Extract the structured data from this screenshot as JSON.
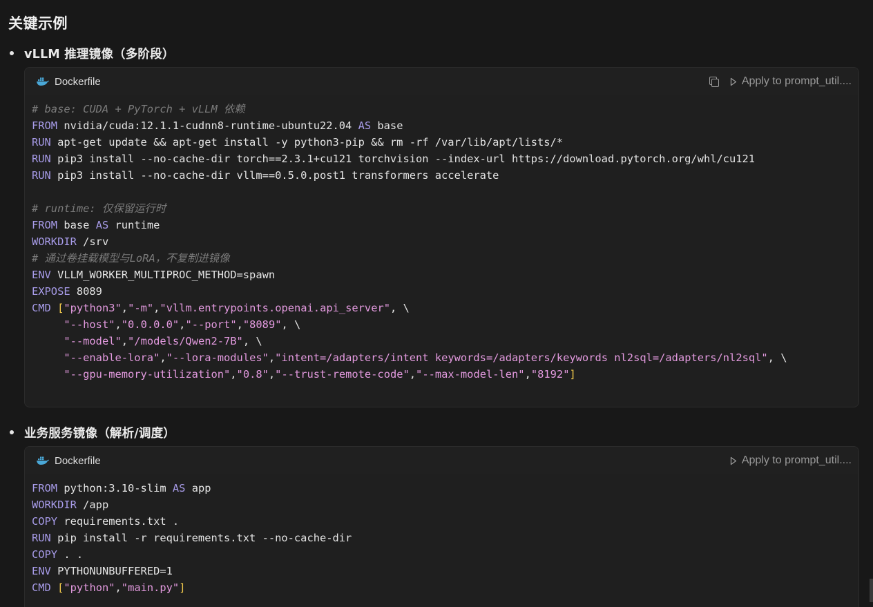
{
  "heading": "关键示例",
  "sections": [
    {
      "bullet": "vLLM 推理镜像（多阶段）",
      "filename": "Dockerfile",
      "apply_label": "Apply to prompt_util....",
      "code_lines": [
        [
          {
            "t": "# base: CUDA + PyTorch + vLLM 依赖",
            "c": "cm"
          }
        ],
        [
          {
            "t": "FROM",
            "c": "kw"
          },
          {
            "t": " nvidia/cuda:12.1.1-cudnn8-runtime-ubuntu22.04 "
          },
          {
            "t": "AS",
            "c": "kw"
          },
          {
            "t": " base"
          }
        ],
        [
          {
            "t": "RUN",
            "c": "kw"
          },
          {
            "t": " apt-get update && apt-get install -y python3-pip && rm -rf /var/lib/apt/lists/*"
          }
        ],
        [
          {
            "t": "RUN",
            "c": "kw"
          },
          {
            "t": " pip3 install --no-cache-dir torch==2.3.1+cu121 torchvision --index-url https://download.pytorch.org/whl/cu121"
          }
        ],
        [
          {
            "t": "RUN",
            "c": "kw"
          },
          {
            "t": " pip3 install --no-cache-dir vllm==0.5.0.post1 transformers accelerate"
          }
        ],
        [
          {
            "t": ""
          }
        ],
        [
          {
            "t": "# runtime: 仅保留运行时",
            "c": "cm"
          }
        ],
        [
          {
            "t": "FROM",
            "c": "kw"
          },
          {
            "t": " base "
          },
          {
            "t": "AS",
            "c": "kw"
          },
          {
            "t": " runtime"
          }
        ],
        [
          {
            "t": "WORKDIR",
            "c": "kw"
          },
          {
            "t": " /srv"
          }
        ],
        [
          {
            "t": "# 通过卷挂载模型与LoRA，不复制进镜像",
            "c": "cm"
          }
        ],
        [
          {
            "t": "ENV",
            "c": "kw"
          },
          {
            "t": " VLLM_WORKER_MULTIPROC_METHOD=spawn"
          }
        ],
        [
          {
            "t": "EXPOSE",
            "c": "kw"
          },
          {
            "t": " 8089"
          }
        ],
        [
          {
            "t": "CMD",
            "c": "kw"
          },
          {
            "t": " "
          },
          {
            "t": "[",
            "c": "br"
          },
          {
            "t": "\"python3\"",
            "c": "str"
          },
          {
            "t": ","
          },
          {
            "t": "\"-m\"",
            "c": "str"
          },
          {
            "t": ","
          },
          {
            "t": "\"vllm.entrypoints.openai.api_server\"",
            "c": "str"
          },
          {
            "t": ", \\"
          }
        ],
        [
          {
            "t": "     "
          },
          {
            "t": "\"--host\"",
            "c": "str"
          },
          {
            "t": ","
          },
          {
            "t": "\"0.0.0.0\"",
            "c": "str"
          },
          {
            "t": ","
          },
          {
            "t": "\"--port\"",
            "c": "str"
          },
          {
            "t": ","
          },
          {
            "t": "\"8089\"",
            "c": "str"
          },
          {
            "t": ", \\"
          }
        ],
        [
          {
            "t": "     "
          },
          {
            "t": "\"--model\"",
            "c": "str"
          },
          {
            "t": ","
          },
          {
            "t": "\"/models/Qwen2-7B\"",
            "c": "str"
          },
          {
            "t": ", \\"
          }
        ],
        [
          {
            "t": "     "
          },
          {
            "t": "\"--enable-lora\"",
            "c": "str"
          },
          {
            "t": ","
          },
          {
            "t": "\"--lora-modules\"",
            "c": "str"
          },
          {
            "t": ","
          },
          {
            "t": "\"intent=/adapters/intent keywords=/adapters/keywords nl2sql=/adapters/nl2sql\"",
            "c": "str"
          },
          {
            "t": ", \\"
          }
        ],
        [
          {
            "t": "     "
          },
          {
            "t": "\"--gpu-memory-utilization\"",
            "c": "str"
          },
          {
            "t": ","
          },
          {
            "t": "\"0.8\"",
            "c": "str"
          },
          {
            "t": ","
          },
          {
            "t": "\"--trust-remote-code\"",
            "c": "str"
          },
          {
            "t": ","
          },
          {
            "t": "\"--max-model-len\"",
            "c": "str"
          },
          {
            "t": ","
          },
          {
            "t": "\"8192\"",
            "c": "str"
          },
          {
            "t": "]",
            "c": "br"
          }
        ]
      ]
    },
    {
      "bullet": "业务服务镜像（解析/调度）",
      "filename": "Dockerfile",
      "apply_label": "Apply to prompt_util....",
      "code_lines": [
        [
          {
            "t": "FROM",
            "c": "kw"
          },
          {
            "t": " python:3.10-slim "
          },
          {
            "t": "AS",
            "c": "kw"
          },
          {
            "t": " app"
          }
        ],
        [
          {
            "t": "WORKDIR",
            "c": "kw"
          },
          {
            "t": " /app"
          }
        ],
        [
          {
            "t": "COPY",
            "c": "kw"
          },
          {
            "t": " requirements.txt ."
          }
        ],
        [
          {
            "t": "RUN",
            "c": "kw"
          },
          {
            "t": " pip install -r requirements.txt --no-cache-dir"
          }
        ],
        [
          {
            "t": "COPY",
            "c": "kw"
          },
          {
            "t": " . ."
          }
        ],
        [
          {
            "t": "ENV",
            "c": "kw"
          },
          {
            "t": " PYTHONUNBUFFERED=1"
          }
        ],
        [
          {
            "t": "CMD",
            "c": "kw"
          },
          {
            "t": " "
          },
          {
            "t": "[",
            "c": "br"
          },
          {
            "t": "\"python\"",
            "c": "str"
          },
          {
            "t": ","
          },
          {
            "t": "\"main.py\"",
            "c": "str"
          },
          {
            "t": "]",
            "c": "br"
          }
        ]
      ]
    }
  ],
  "colors": {
    "keyword": "#a79be8",
    "comment": "#7b7b7b",
    "string": "#e39adf",
    "bracket": "#f2c94c",
    "background": "#181818",
    "code_background": "#1f1f1f"
  },
  "icons": {
    "file": "docker-whale-icon",
    "copy": "copy-icon",
    "apply": "play-icon"
  }
}
